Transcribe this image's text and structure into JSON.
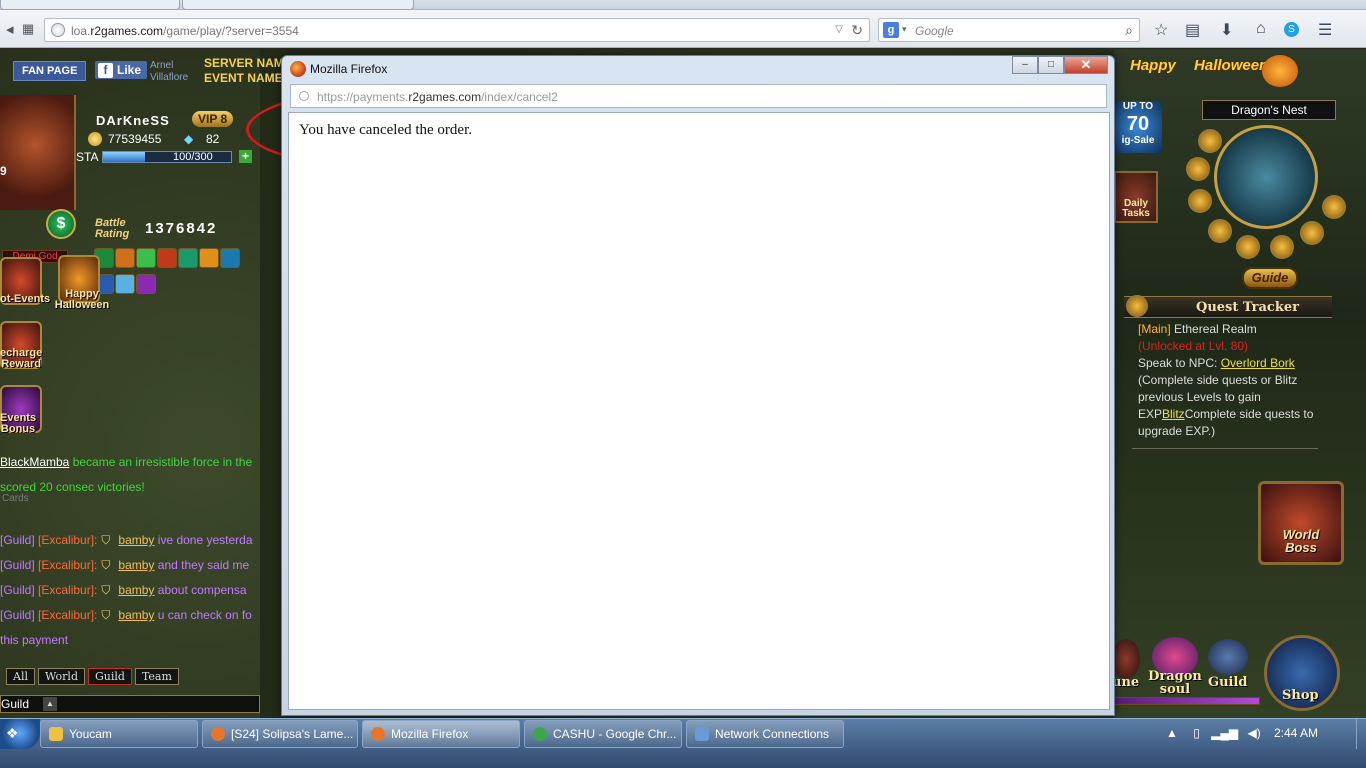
{
  "browser": {
    "url_prefix": "loa.",
    "url_domain": "r2games.com",
    "url_path": "/game/play/?server=3554",
    "search_engine_letter": "g",
    "search_placeholder": "Google"
  },
  "game": {
    "fan_page": "FAN PAGE",
    "fb_like": "Like",
    "fb_user_first": "Arnel",
    "fb_user_last": "Villaflore",
    "server_label": "SERVER NAME",
    "event_label": "EVENT NAME:",
    "player": {
      "level": "9",
      "name": "DArKneSS",
      "vip": "VIP 8",
      "gold": "77539455",
      "gems": "82",
      "sta_label": "STA",
      "sta_value": "100/300",
      "sta_fraction": 0.33,
      "battle_label_1": "Battle",
      "battle_label_2": "Rating",
      "battle_rating": "1376842",
      "title": "Demi God"
    },
    "left_icons": [
      {
        "label_1": "ot-Events",
        "label_2": ""
      },
      {
        "label_1": "Happy",
        "label_2": "Halloween"
      },
      {
        "label_1": "echarge",
        "label_2": "Reward"
      },
      {
        "label_1": "Events",
        "label_2": "Bonus"
      }
    ],
    "chat": {
      "system_player": "BlackMamba",
      "system_text_1": " became an irresistible force in the",
      "system_text_2": "scored 20 consec victories!",
      "cards": "Cards",
      "messages": [
        {
          "channel": "[Guild]",
          "guild": "[Excalibur]:",
          "player": "bamby",
          "text": "ive done yesterda"
        },
        {
          "channel": "[Guild]",
          "guild": "[Excalibur]:",
          "player": "bamby",
          "text": "and they said me"
        },
        {
          "channel": "[Guild]",
          "guild": "[Excalibur]:",
          "player": "bamby",
          "text": "about compensa"
        },
        {
          "channel": "[Guild]",
          "guild": "[Excalibur]:",
          "player": "bamby",
          "text": "u can check on fo"
        }
      ],
      "continuation": "this payment",
      "tabs": [
        "All",
        "World",
        "Guild",
        "Team"
      ],
      "input_channel": "Guild"
    },
    "right": {
      "halloween_1": "Happy",
      "halloween_2": "Halloween!",
      "upto_1": "UP TO",
      "upto_n": "70",
      "upto_2": "ig-Sale",
      "dragons_nest": "Dragon's Nest",
      "daily_1": "Daily",
      "daily_2": "Tasks",
      "guide": "Guide",
      "quest_tracker": "Quest Tracker",
      "quest_main_tag": "[Main]",
      "quest_main_name": " Ethereal Realm",
      "quest_unlock": "(Unlocked at Lvl. 80)",
      "quest_speak": "Speak to NPC: ",
      "quest_npc": "Overlord Bork",
      "quest_desc_1": "(Complete side quests or Blitz previous Levels to gain EXP",
      "quest_blitz": "Blitz",
      "quest_desc_2": "Complete side quests to upgrade EXP.)",
      "world_boss_1": "World",
      "world_boss_2": "Boss",
      "btn_rune": "une",
      "btn_dragon_1": "Dragon",
      "btn_dragon_2": "soul",
      "btn_guild": "Guild",
      "btn_shop": "Shop"
    }
  },
  "popup": {
    "title": "Mozilla Firefox",
    "min": "–",
    "max": "□",
    "close": "✕",
    "url_scheme": "https://payments.",
    "url_domain": "r2games.com",
    "url_path": "/index/cancel2",
    "message": "You have canceled the order."
  },
  "taskbar": {
    "items": [
      {
        "label": "Youcam",
        "color": "#f0c040"
      },
      {
        "label": "[S24] Solipsa's Lame...",
        "color": "#e8762a"
      },
      {
        "label": "Mozilla Firefox",
        "color": "#e8762a"
      },
      {
        "label": "CASHU - Google Chr...",
        "color": "#3aa84a"
      },
      {
        "label": "Network Connections",
        "color": "#6a9ad8"
      }
    ],
    "clock": "2:44 AM"
  }
}
